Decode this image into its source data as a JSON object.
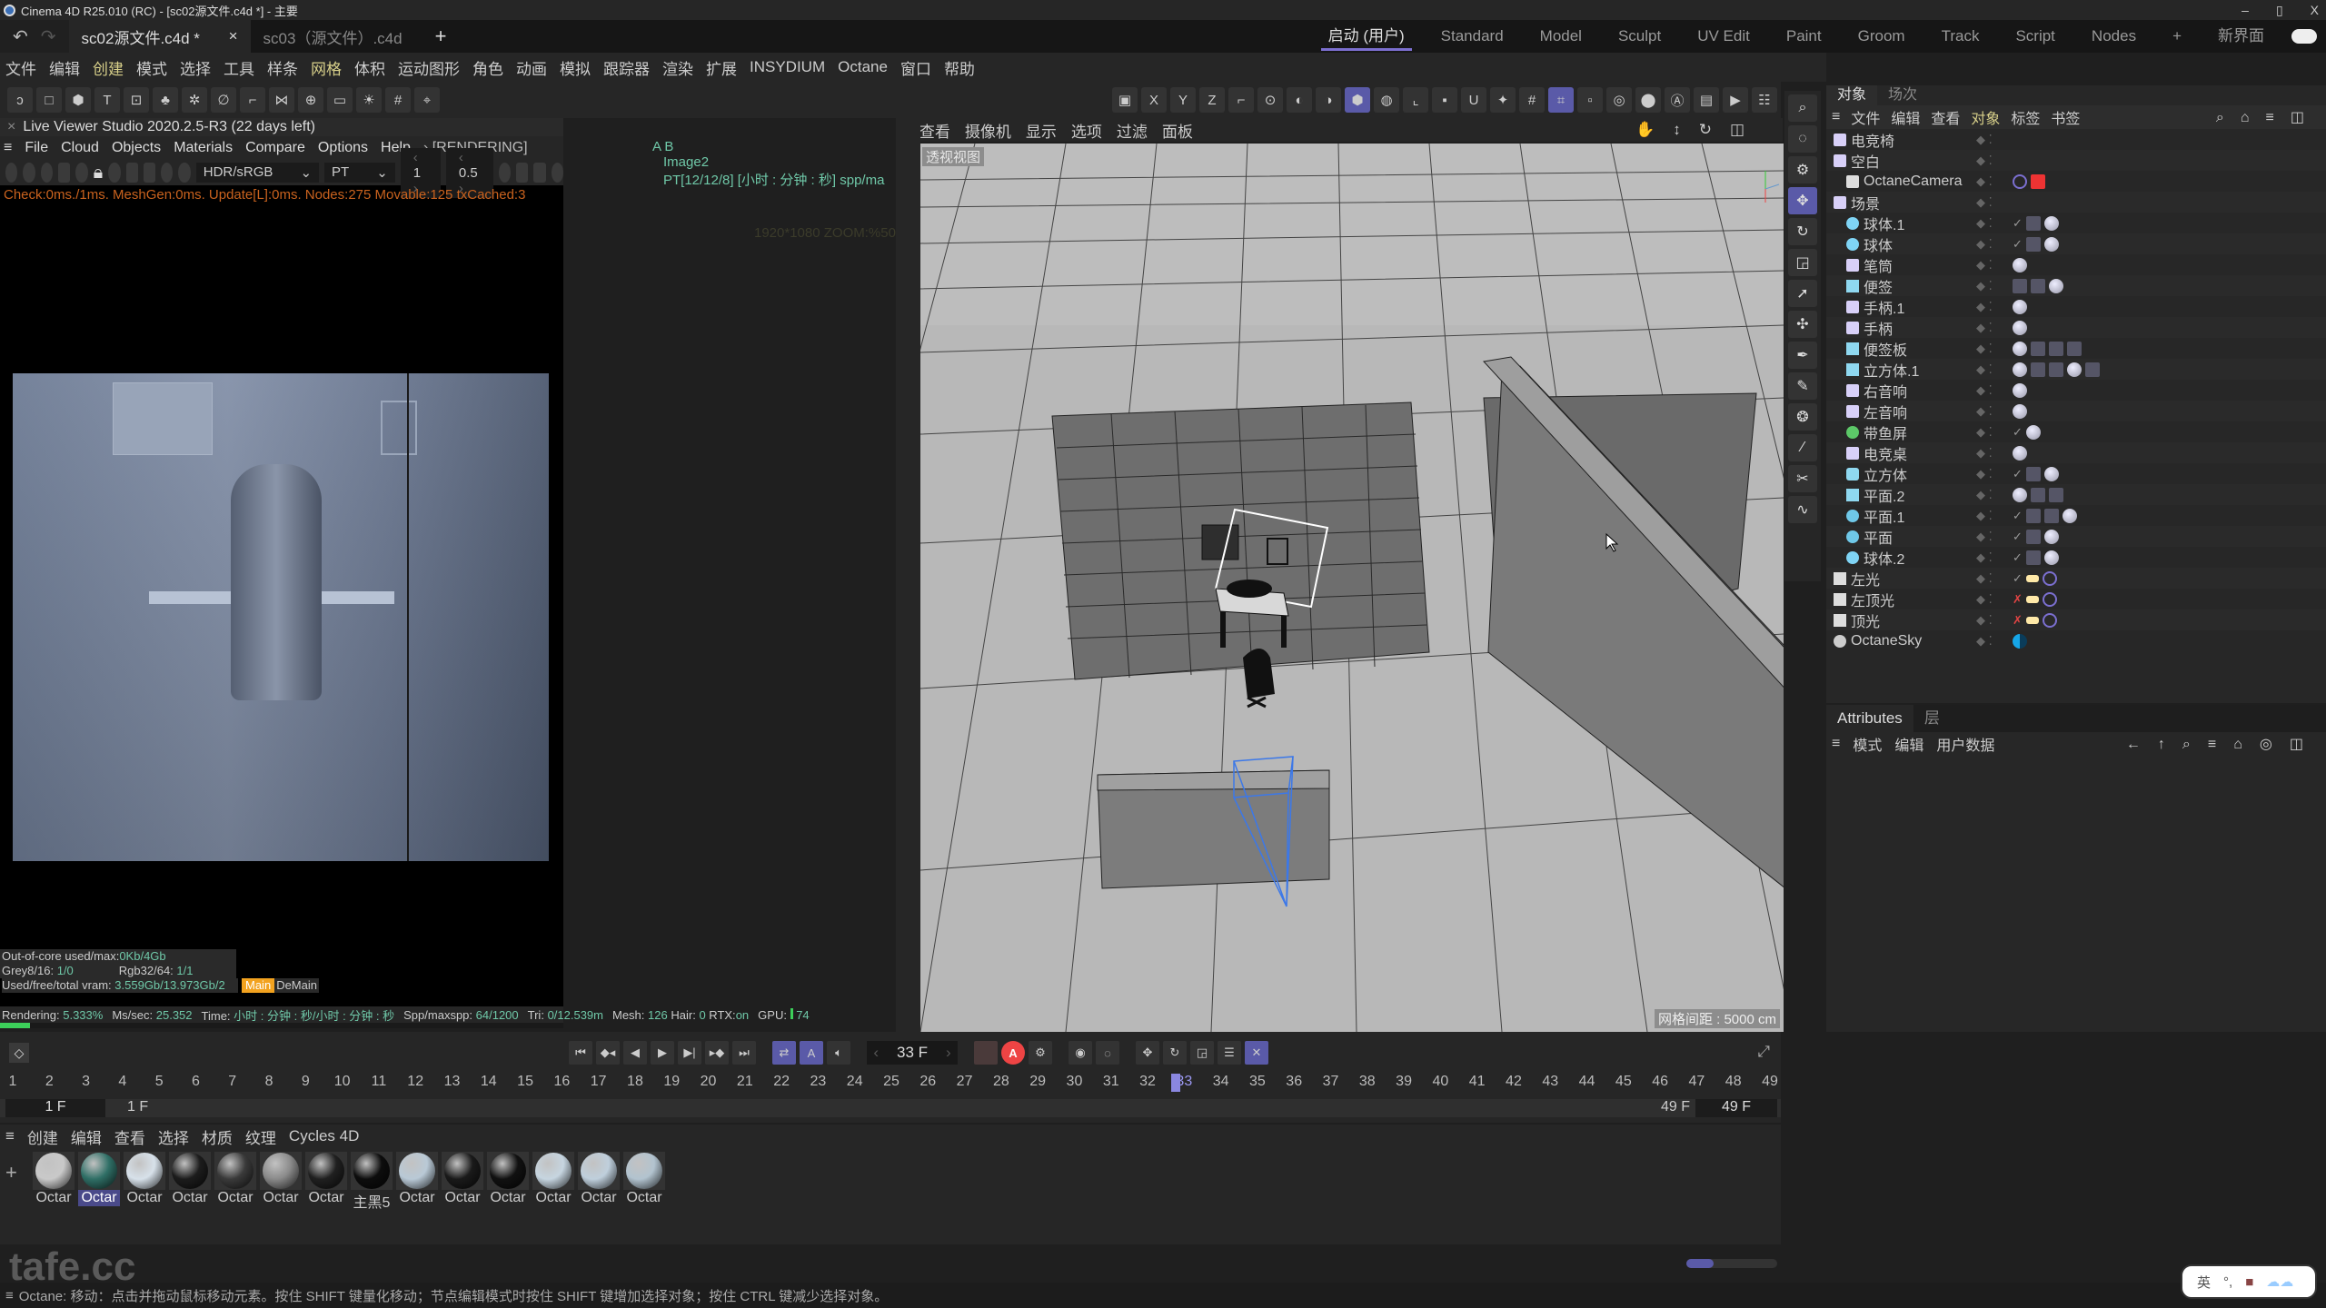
{
  "app": {
    "title": "Cinema 4D R25.010 (RC) - [sc02源文件.c4d *] - 主要",
    "window_controls": [
      "–",
      "▯",
      "X"
    ]
  },
  "doc_tabs": [
    {
      "label": "sc02源文件.c4d *",
      "active": true,
      "close": "×"
    },
    {
      "label": "sc03（源文件）.c4d",
      "active": false
    }
  ],
  "layouts": {
    "items": [
      "启动 (用户)",
      "Standard",
      "Model",
      "Sculpt",
      "UV Edit",
      "Paint",
      "Groom",
      "Track",
      "Script",
      "Nodes"
    ],
    "active": "启动 (用户)",
    "add": "+",
    "new_ui": "新界面"
  },
  "menubar": [
    "文件",
    "编辑",
    "创建",
    "模式",
    "选择",
    "工具",
    "样条",
    "网格",
    "体积",
    "运动图形",
    "角色",
    "动画",
    "模拟",
    "跟踪器",
    "渲染",
    "扩展",
    "INSYDIUM",
    "Octane",
    "窗口",
    "帮助"
  ],
  "menubar_highlight": [
    "创建",
    "网格"
  ],
  "toolbar_icons": [
    "null-object-icon",
    "rectangle-select-icon",
    "cube-icon",
    "text-icon",
    "select-points-icon",
    "cloner-icon",
    "effector-icon",
    "spline-icon",
    "deformer-icon",
    "symmetry-icon",
    "environment-icon",
    "camera-icon",
    "light-icon",
    "grid-icon",
    "snap-icon"
  ],
  "viewport_toolbar_icons": [
    "render-region-icon",
    "x-axis-icon",
    "y-axis-icon",
    "z-axis-icon",
    "coord-system-icon",
    "points-mode-icon",
    "edges-mode-icon",
    "polygons-mode-icon",
    "model-mode-icon",
    "texture-mode-icon",
    "axis-mode-icon",
    "workplane-icon",
    "magnet-icon",
    "snap-settings-icon",
    "grid-snap-icon",
    "quantize-icon",
    "render-view-icon",
    "render-settings-icon",
    "render-picture-viewer-icon",
    "octane-icon",
    "clapper-icon",
    "play-render-icon",
    "render-queue-icon"
  ],
  "live_viewer": {
    "title": "Live Viewer Studio 2020.2.5-R3 (22 days left)",
    "menu": [
      "File",
      "Cloud",
      "Objects",
      "Materials",
      "Compare",
      "Options",
      "Help"
    ],
    "status_tag": "[RENDERING]",
    "color_space": "HDR/sRGB",
    "kernel": "PT",
    "value1": "1",
    "value2": "0.5",
    "check_line": "Check:0ms./1ms. MeshGen:0ms. Update[L]:0ms. Nodes:275 Movable:125 txCached:3",
    "ab_label": "A B",
    "image_label": "Image2",
    "pt_line": "PT[12/12/8] [小时 : 分钟 : 秒] spp/ma",
    "resolution": "1920*1080 ZOOM:%50",
    "stats": {
      "out_of_core_label": "Out-of-core used/max:",
      "out_of_core_value": "0Kb/4Gb",
      "grey_label": "Grey8/16:",
      "grey_value": "1/0",
      "rgb_label": "Rgb32/64:",
      "rgb_value": "1/1",
      "vram_label": "Used/free/total vram:",
      "vram_value": "3.559Gb/13.973Gb/2",
      "main_btn": "Main",
      "demain_btn": "DeMain"
    },
    "render_line": {
      "rendering_label": "Rendering:",
      "rendering_value": "5.333%",
      "ms_label": "Ms/sec:",
      "ms_value": "25.352",
      "time_label": "Time:",
      "time_value": "小时 : 分钟 : 秒/小时 : 分钟 : 秒",
      "spp_label": "Spp/maxspp:",
      "spp_value": "64/1200",
      "tri_label": "Tri:",
      "tri_value": "0/12.539m",
      "mesh_label": "Mesh:",
      "mesh_value": "126",
      "hair_label": "Hair:",
      "hair_value": "0",
      "rtx_label": "RTX:",
      "rtx_value": "on",
      "gpu_label": "GPU:",
      "gpu_value": "74"
    },
    "progress": 0.05333
  },
  "viewport": {
    "menu": [
      "查看",
      "摄像机",
      "显示",
      "选项",
      "过滤",
      "面板"
    ],
    "label": "透视视图",
    "grid_spacing": "网格间距 : 5000 cm",
    "nav_icons": [
      "pan-icon",
      "dolly-icon",
      "rotate-view-icon",
      "maximize-view-icon"
    ]
  },
  "side_tools": [
    "live-select-icon",
    "move-tool-settings-icon",
    "move-icon",
    "rotate-icon",
    "scale-icon",
    "transfer-icon",
    "multi-move-icon",
    "spline-pen-icon",
    "spline-sketch-icon",
    "spline-smooth-icon",
    "brush-icon",
    "spline-cut-icon",
    "spline-arc-icon"
  ],
  "object_manager": {
    "tabs": [
      "对象",
      "场次"
    ],
    "menu": [
      "文件",
      "编辑",
      "查看",
      "对象",
      "标签",
      "书签"
    ],
    "menu_highlight": "对象",
    "objects": [
      {
        "name": "电竞椅",
        "type": "null",
        "depth": 0,
        "check": "",
        "tags": []
      },
      {
        "name": "空白",
        "type": "null",
        "depth": 0,
        "check": "",
        "tags": []
      },
      {
        "name": "OctaneCamera",
        "type": "camera",
        "depth": 1,
        "check": "",
        "tags": [
          "target",
          "cam-red"
        ]
      },
      {
        "name": "场景",
        "type": "null",
        "depth": 0,
        "check": "",
        "tags": []
      },
      {
        "name": "球体.1",
        "type": "sphere",
        "depth": 1,
        "check": "✓",
        "tags": [
          "phong",
          "mat"
        ]
      },
      {
        "name": "球体",
        "type": "sphere",
        "depth": 1,
        "check": "✓",
        "tags": [
          "phong",
          "mat"
        ]
      },
      {
        "name": "笔筒",
        "type": "null",
        "depth": 1,
        "check": "",
        "tags": [
          "mat"
        ]
      },
      {
        "name": "便签",
        "type": "poly",
        "depth": 1,
        "check": "",
        "tags": [
          "uvw",
          "phong",
          "mat"
        ]
      },
      {
        "name": "手柄.1",
        "type": "null",
        "depth": 1,
        "check": "",
        "tags": [
          "mat"
        ]
      },
      {
        "name": "手柄",
        "type": "null",
        "depth": 1,
        "check": "",
        "tags": [
          "mat"
        ]
      },
      {
        "name": "便签板",
        "type": "poly",
        "depth": 1,
        "check": "",
        "tags": [
          "mat",
          "selection",
          "phong",
          "uvw"
        ]
      },
      {
        "name": "立方体.1",
        "type": "poly",
        "depth": 1,
        "check": "",
        "tags": [
          "mat",
          "phong",
          "uvw",
          "mat",
          "selection"
        ]
      },
      {
        "name": "右音响",
        "type": "null",
        "depth": 1,
        "check": "",
        "tags": [
          "mat"
        ]
      },
      {
        "name": "左音响",
        "type": "null",
        "depth": 1,
        "check": "",
        "tags": [
          "mat"
        ]
      },
      {
        "name": "带鱼屏",
        "type": "symmetry",
        "depth": 1,
        "check": "✓",
        "tags": [
          "mat"
        ]
      },
      {
        "name": "电竞桌",
        "type": "null",
        "depth": 1,
        "check": "",
        "tags": [
          "mat"
        ]
      },
      {
        "name": "立方体",
        "type": "cube",
        "depth": 1,
        "check": "✓",
        "tags": [
          "phong",
          "mat"
        ]
      },
      {
        "name": "平面.2",
        "type": "poly",
        "depth": 1,
        "check": "",
        "tags": [
          "mat",
          "phong",
          "uvw"
        ]
      },
      {
        "name": "平面.1",
        "type": "plane",
        "depth": 1,
        "check": "✓",
        "tags": [
          "phong",
          "unknown",
          "mat"
        ]
      },
      {
        "name": "平面",
        "type": "plane",
        "depth": 1,
        "check": "✓",
        "tags": [
          "phong",
          "mat"
        ]
      },
      {
        "name": "球体.2",
        "type": "sphere",
        "depth": 1,
        "check": "✓",
        "tags": [
          "phong",
          "mat"
        ]
      },
      {
        "name": "左光",
        "type": "light",
        "depth": 0,
        "check": "✓",
        "tags": [
          "light",
          "target"
        ]
      },
      {
        "name": "左顶光",
        "type": "light",
        "depth": 0,
        "check": "✗",
        "tags": [
          "light",
          "target"
        ]
      },
      {
        "name": "顶光",
        "type": "light",
        "depth": 0,
        "check": "✗",
        "tags": [
          "light",
          "target"
        ]
      },
      {
        "name": "OctaneSky",
        "type": "sky",
        "depth": 0,
        "check": "",
        "tags": [
          "sky"
        ]
      }
    ]
  },
  "attributes": {
    "tabs": [
      "Attributes",
      "层"
    ],
    "menu": [
      "模式",
      "编辑",
      "用户数据"
    ],
    "nav_icons": [
      "back-icon",
      "up-icon",
      "search-icon",
      "filter-icon",
      "lock-icon",
      "target-icon",
      "new-window-icon"
    ]
  },
  "timeline": {
    "current_frame": "33 F",
    "current_frame_num": 33,
    "frames": [
      1,
      2,
      3,
      4,
      5,
      6,
      7,
      8,
      9,
      10,
      11,
      12,
      13,
      14,
      15,
      16,
      17,
      18,
      19,
      20,
      21,
      22,
      23,
      24,
      25,
      26,
      27,
      28,
      29,
      30,
      31,
      32,
      33,
      34,
      35,
      36,
      37,
      38,
      39,
      40,
      41,
      42,
      43,
      44,
      45,
      46,
      47,
      48,
      49
    ],
    "start": "1 F",
    "range_start": "1 F",
    "range_end": "49 F",
    "end": "49 F",
    "controls": [
      "go-start-icon",
      "prev-key-icon",
      "prev-frame-icon",
      "play-icon",
      "next-frame-icon",
      "next-key-icon",
      "go-end-icon"
    ],
    "mode_controls": [
      "loop-icon",
      "playback-mode-icon",
      "sound-icon"
    ],
    "key_controls": [
      "record-disabled-icon",
      "autokey-icon",
      "key-settings-icon",
      "motion-record-icon",
      "dope-icon",
      "key-position-icon",
      "key-rotation-icon",
      "key-scale-icon",
      "key-param-icon",
      "key-pla-icon"
    ]
  },
  "materials": {
    "menu": [
      "创建",
      "编辑",
      "查看",
      "选择",
      "材质",
      "纹理",
      "Cycles 4D"
    ],
    "items": [
      {
        "label": "Octar",
        "color": "#c9c9c9",
        "selected": false
      },
      {
        "label": "Octar",
        "color": "#2f6f66",
        "selected": true
      },
      {
        "label": "Octar",
        "color": "#d7e1ea",
        "selected": false
      },
      {
        "label": "Octar",
        "color": "#1c1c1c",
        "selected": false
      },
      {
        "label": "Octar",
        "color": "#3a3a3a",
        "selected": false
      },
      {
        "label": "Octar",
        "color": "#8a8a8a",
        "selected": false
      },
      {
        "label": "Octar",
        "color": "#202020",
        "selected": false
      },
      {
        "label": "主黑5",
        "color": "#0d0d0d",
        "selected": false
      },
      {
        "label": "Octar",
        "color": "#b9c9d6",
        "selected": false
      },
      {
        "label": "Octar",
        "color": "#1a1a1a",
        "selected": false
      },
      {
        "label": "Octar",
        "color": "#111111",
        "selected": false
      },
      {
        "label": "Octar",
        "color": "#c6d5e0",
        "selected": false
      },
      {
        "label": "Octar",
        "color": "#bfcfdc",
        "selected": false
      },
      {
        "label": "Octar",
        "color": "#b2c3cf",
        "selected": false
      }
    ],
    "add": "+"
  },
  "statusbar": {
    "text": "Octane:   移动：点击并拖动鼠标移动元素。按住 SHIFT 键量化移动；节点编辑模式时按住 SHIFT 键增加选择对象；按住 CTRL 键减少选择对象。"
  },
  "ime": {
    "lang": "英",
    "punct": "°,"
  },
  "watermark": "tafe.cc",
  "zoom_slider": 0.3,
  "colors": {
    "accent": "#5a5aa8",
    "layout_underline": "#7c6fd0",
    "menu_highlight": "#d8d08a",
    "check_text": "#c9621e",
    "stat_value": "#6fc8a8",
    "progress": "#3ccf5a",
    "record": "#e44444"
  }
}
